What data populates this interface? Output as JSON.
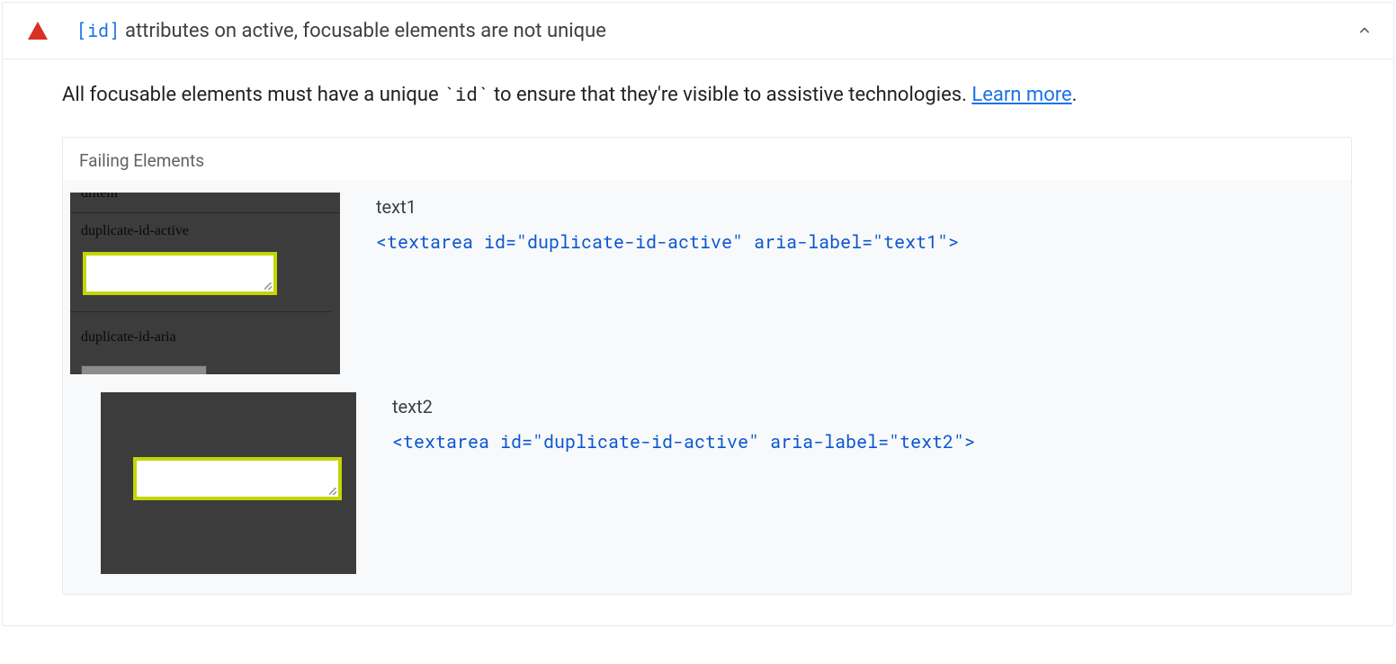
{
  "audit": {
    "code_token": "[id]",
    "title_rest": " attributes on active, focusable elements are not unique",
    "description_before": "All focusable elements must have a unique ",
    "description_code": "`id`",
    "description_after": " to ensure that they're visible to assistive technologies. ",
    "learn_more": "Learn more",
    "period": "."
  },
  "failing": {
    "heading": "Failing Elements",
    "items": [
      {
        "label": "text1",
        "snippet": "<textarea id=\"duplicate-id-active\" aria-label=\"text1\">",
        "thumb": {
          "label_top_cut": "dlitem",
          "label1": "duplicate-id-active",
          "label2": "duplicate-id-aria"
        }
      },
      {
        "label": "text2",
        "snippet": "<textarea id=\"duplicate-id-active\" aria-label=\"text2\">"
      }
    ]
  }
}
